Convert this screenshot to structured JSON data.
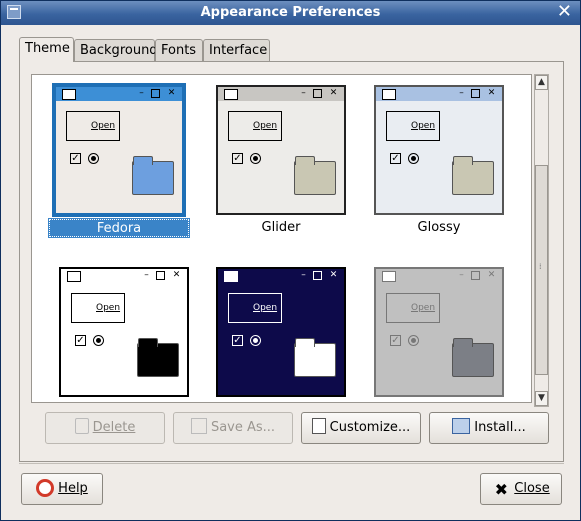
{
  "window": {
    "title": "Appearance Preferences",
    "close_glyph": "✕"
  },
  "tabs": [
    {
      "label": "Theme",
      "active": true
    },
    {
      "label": "Background",
      "active": false
    },
    {
      "label": "Fonts",
      "active": false
    },
    {
      "label": "Interface",
      "active": false
    }
  ],
  "themes": [
    {
      "name": "Fedora",
      "selected": true,
      "open_label": "Open",
      "frame": "#1e6fb5",
      "titlebar": "#3d8fd6",
      "body": "#efebe7",
      "folder": "#6d9fdf",
      "fg": "#000"
    },
    {
      "name": "Glider",
      "selected": false,
      "open_label": "Open",
      "frame": "#222",
      "titlebar": "#c8c6c2",
      "body": "#edece9",
      "folder": "#c9c7b3",
      "fg": "#000"
    },
    {
      "name": "Glossy",
      "selected": false,
      "open_label": "Open",
      "frame": "#555",
      "titlebar": "#a9c1e2",
      "body": "#e9edf2",
      "folder": "#c9c7b3",
      "fg": "#000"
    },
    {
      "name": "",
      "selected": false,
      "open_label": "Open",
      "frame": "#000",
      "titlebar": "#ffffff",
      "body": "#ffffff",
      "folder": "#000000",
      "fg": "#000"
    },
    {
      "name": "",
      "selected": false,
      "open_label": "Open",
      "frame": "#000",
      "titlebar": "#0d0a4a",
      "body": "#0d0a4a",
      "folder": "#ffffff",
      "fg": "#fff"
    },
    {
      "name": "",
      "selected": false,
      "open_label": "Open",
      "frame": "#777",
      "titlebar": "#c0c0c0",
      "body": "#c0c0c0",
      "folder": "#7c7f86",
      "fg": "#777"
    }
  ],
  "buttons": {
    "delete": "Delete",
    "save_as": "Save As...",
    "customize": "Customize...",
    "install": "Install...",
    "help": "Help",
    "close": "Close"
  },
  "colors": {
    "selection": "#3a84c8",
    "titlebar": "#3a64a0"
  }
}
